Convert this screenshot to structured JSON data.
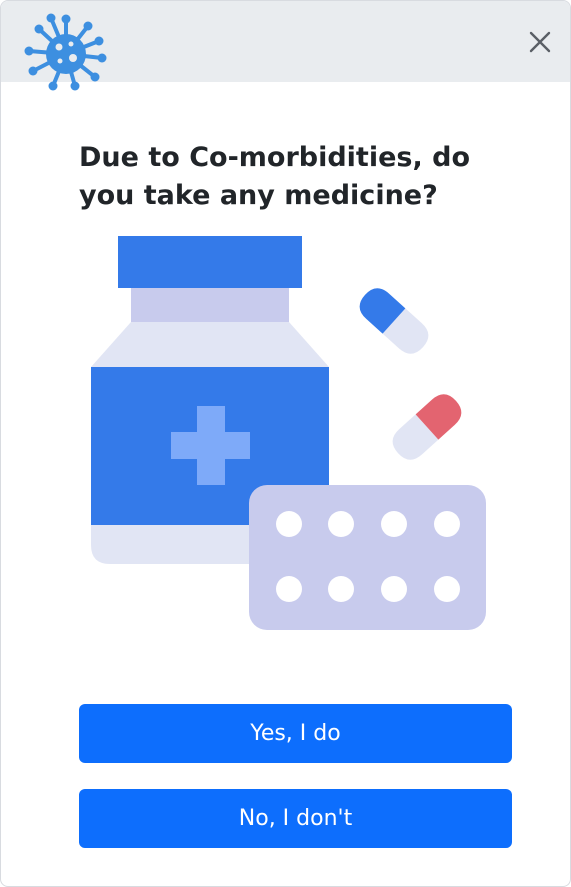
{
  "dialog": {
    "logo_icon": "virus-icon",
    "close_icon": "close-icon",
    "question": "Due to Co-morbidities, do you take any medicine?",
    "illustration": "medicine-bottle-and-pills-illustration",
    "options": [
      {
        "label": "Yes, I do"
      },
      {
        "label": "No, I don't"
      }
    ]
  },
  "colors": {
    "header_bg": "#e9ecef",
    "button_primary": "#0d6efd",
    "logo_blue": "#3d8fe0",
    "bottle_blue": "#347ae9",
    "bottle_light": "#e1e5f4",
    "blister_lavender": "#c8cbed",
    "pill_red": "#e36470"
  }
}
